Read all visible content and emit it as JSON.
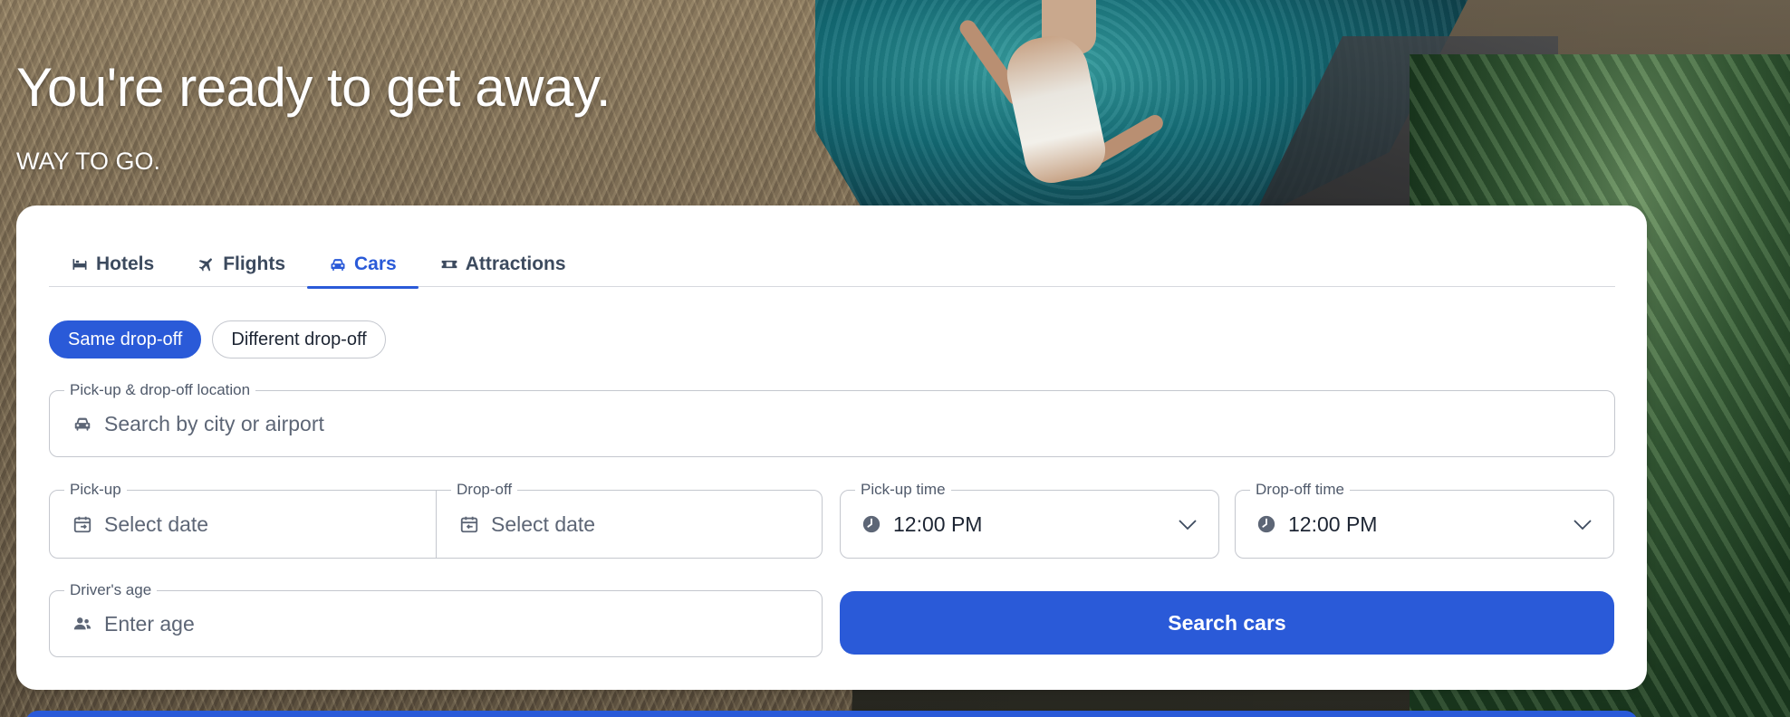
{
  "hero": {
    "headline": "You're ready to get away.",
    "subheadline": "WAY TO GO."
  },
  "tabs": [
    {
      "label": "Hotels",
      "icon": "bed-icon",
      "active": false
    },
    {
      "label": "Flights",
      "icon": "plane-icon",
      "active": false
    },
    {
      "label": "Cars",
      "icon": "car-icon",
      "active": true
    },
    {
      "label": "Attractions",
      "icon": "ticket-icon",
      "active": false
    }
  ],
  "dropoff_options": {
    "same": "Same drop-off",
    "different": "Different drop-off",
    "selected": "same"
  },
  "location": {
    "label": "Pick-up & drop-off location",
    "placeholder": "Search by city or airport",
    "icon": "car-icon"
  },
  "pickup_date": {
    "label": "Pick-up",
    "placeholder": "Select date",
    "icon": "calendar-out-icon"
  },
  "dropoff_date": {
    "label": "Drop-off",
    "placeholder": "Select date",
    "icon": "calendar-in-icon"
  },
  "pickup_time": {
    "label": "Pick-up time",
    "value": "12:00 PM",
    "icon": "clock-icon"
  },
  "dropoff_time": {
    "label": "Drop-off time",
    "value": "12:00 PM",
    "icon": "clock-icon"
  },
  "driver_age": {
    "label": "Driver's age",
    "placeholder": "Enter age",
    "icon": "people-icon"
  },
  "search_button": {
    "label": "Search cars"
  },
  "colors": {
    "accent": "#2a5ad8",
    "text": "#1d2533",
    "muted": "#5d6676",
    "border": "#c4c7ce"
  }
}
